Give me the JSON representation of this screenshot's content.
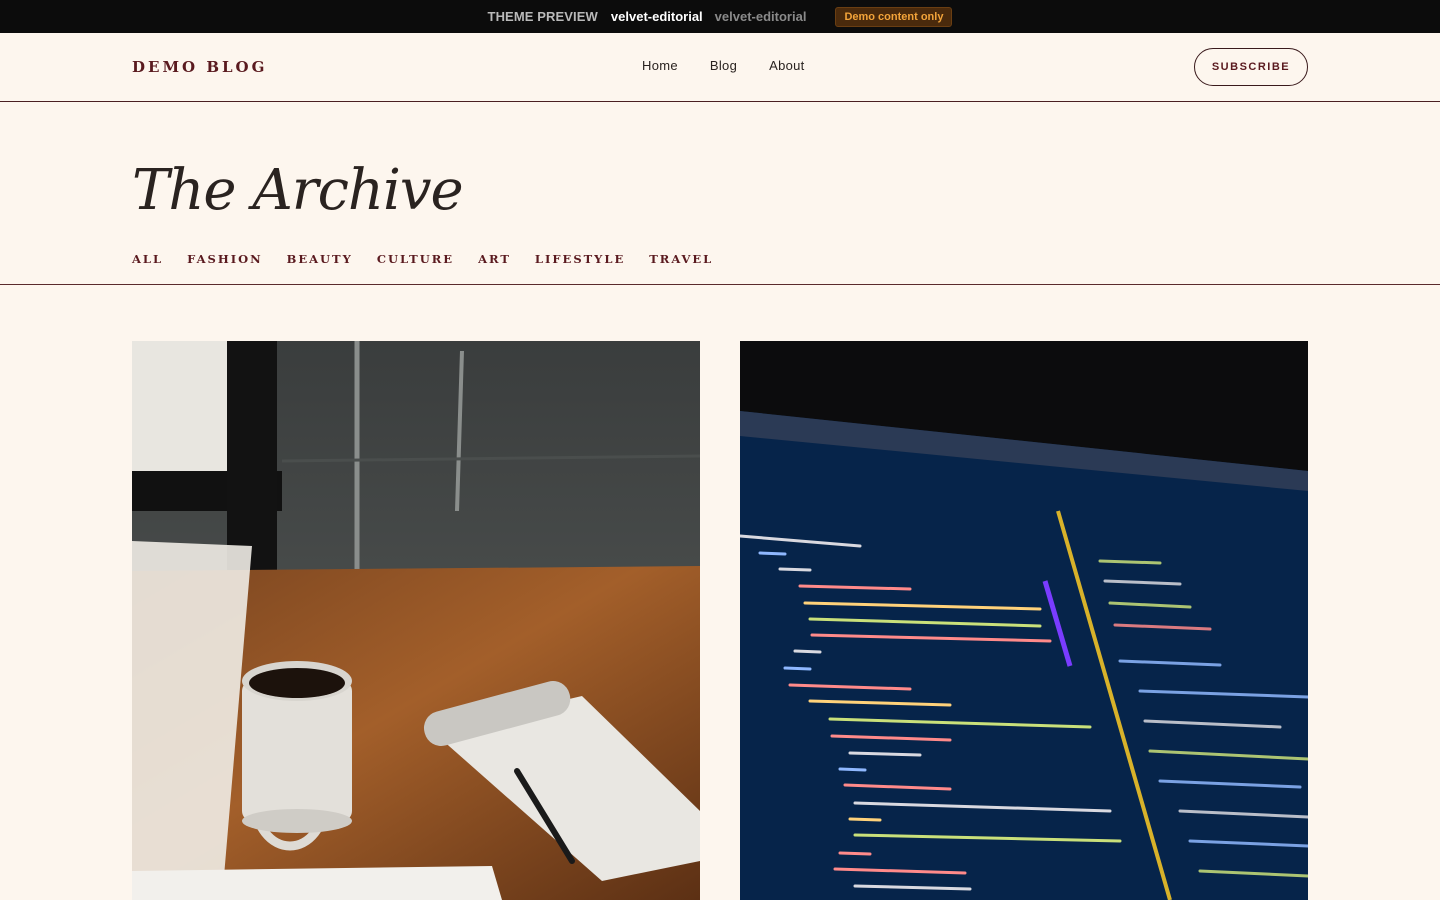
{
  "preview_bar": {
    "label": "THEME PREVIEW",
    "theme_name": "velvet-editorial",
    "theme_slug": "velvet-editorial",
    "badge": "Demo content only"
  },
  "header": {
    "brand": "DEMO BLOG",
    "nav": [
      "Home",
      "Blog",
      "About"
    ],
    "subscribe": "SUBSCRIBE"
  },
  "hero": {
    "title": "The Archive",
    "categories": [
      "ALL",
      "FASHION",
      "BEAUTY",
      "CULTURE",
      "ART",
      "LIFESTYLE",
      "TRAVEL"
    ]
  },
  "posts": [
    {
      "image": "coffee-mug-notebook-photo"
    },
    {
      "image": "code-editor-screen-photo"
    }
  ],
  "colors": {
    "background": "#fdf6ee",
    "accent": "#5a1a1f",
    "preview_bar": "#0c0c0c",
    "badge_text": "#f3a43a"
  }
}
